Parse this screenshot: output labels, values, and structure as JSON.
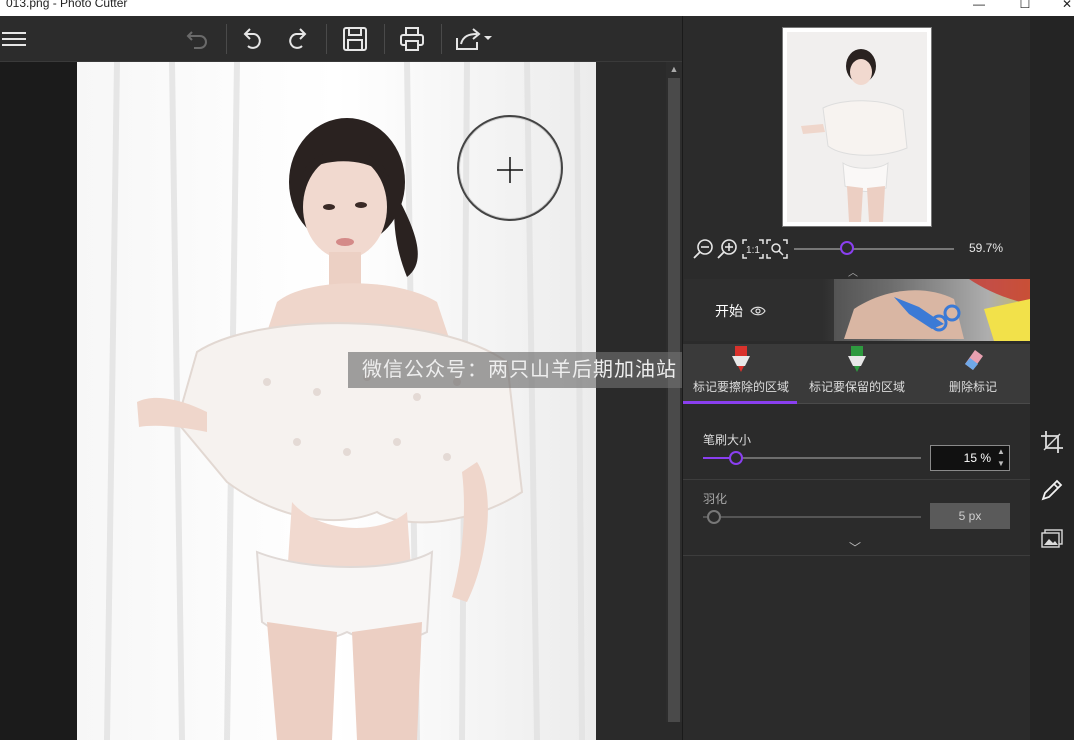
{
  "window": {
    "title": "013.png - Photo Cutter",
    "minimize": "—",
    "maximize": "☐",
    "close": "✕"
  },
  "toolbar": {
    "icons": [
      "menu-icon",
      "undo-disabled-icon",
      "undo-icon",
      "redo-icon",
      "save-icon",
      "print-icon",
      "share-icon"
    ]
  },
  "canvas": {
    "watermark": "微信公众号：两只山羊后期加油站"
  },
  "navigator": {
    "zoom_value": "59.7%",
    "zoom_level": 0.33,
    "fit_label": "1:1"
  },
  "banner": {
    "start_label": "开始"
  },
  "modes": [
    {
      "label": "标记要擦除的区域",
      "icon": "red-marker-icon",
      "color": "#d9322c"
    },
    {
      "label": "标记要保留的区域",
      "icon": "green-marker-icon",
      "color": "#2e9a3f"
    },
    {
      "label": "删除标记",
      "icon": "eraser-icon",
      "color": "#e8a0b0"
    }
  ],
  "brush": {
    "label": "笔刷大小",
    "value": "15 %",
    "level": 0.15
  },
  "feather": {
    "label": "羽化",
    "value": "5 px",
    "level": 0.05
  },
  "colors": {
    "accent": "#8a3ff0",
    "panel": "#2b2b2b"
  }
}
